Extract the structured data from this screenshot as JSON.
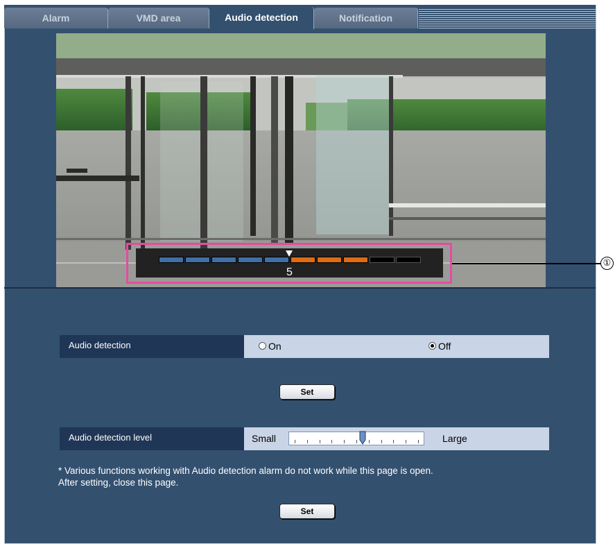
{
  "tabs": [
    {
      "label": "Alarm"
    },
    {
      "label": "VMD area"
    },
    {
      "label": "Audio detection"
    },
    {
      "label": "Notification"
    }
  ],
  "active_tab": "Audio detection",
  "level_meter": {
    "value_label": "5",
    "segments_total": 10,
    "blue_segments": 5,
    "orange_segments": 3,
    "colors": {
      "low": "#3f6fa6",
      "high": "#e06c12",
      "empty": "#000000"
    }
  },
  "callout": {
    "label": "①"
  },
  "audio_detection": {
    "label": "Audio detection",
    "options": [
      {
        "label": "On"
      },
      {
        "label": "Off"
      }
    ],
    "selected": "Off"
  },
  "set_button_1": {
    "label": "Set"
  },
  "audio_detection_level": {
    "label": "Audio detection level",
    "min_label": "Small",
    "max_label": "Large",
    "level_fraction": 0.55
  },
  "note": {
    "line1": "* Various functions working with Audio detection alarm do not work while this page is open.",
    "line2": "After setting, close this page."
  },
  "set_button_2": {
    "label": "Set"
  },
  "colors": {
    "panel": "#33506f",
    "label_bg": "#203656",
    "value_bg": "#c9d5e7",
    "highlight": "#e64ca0"
  }
}
